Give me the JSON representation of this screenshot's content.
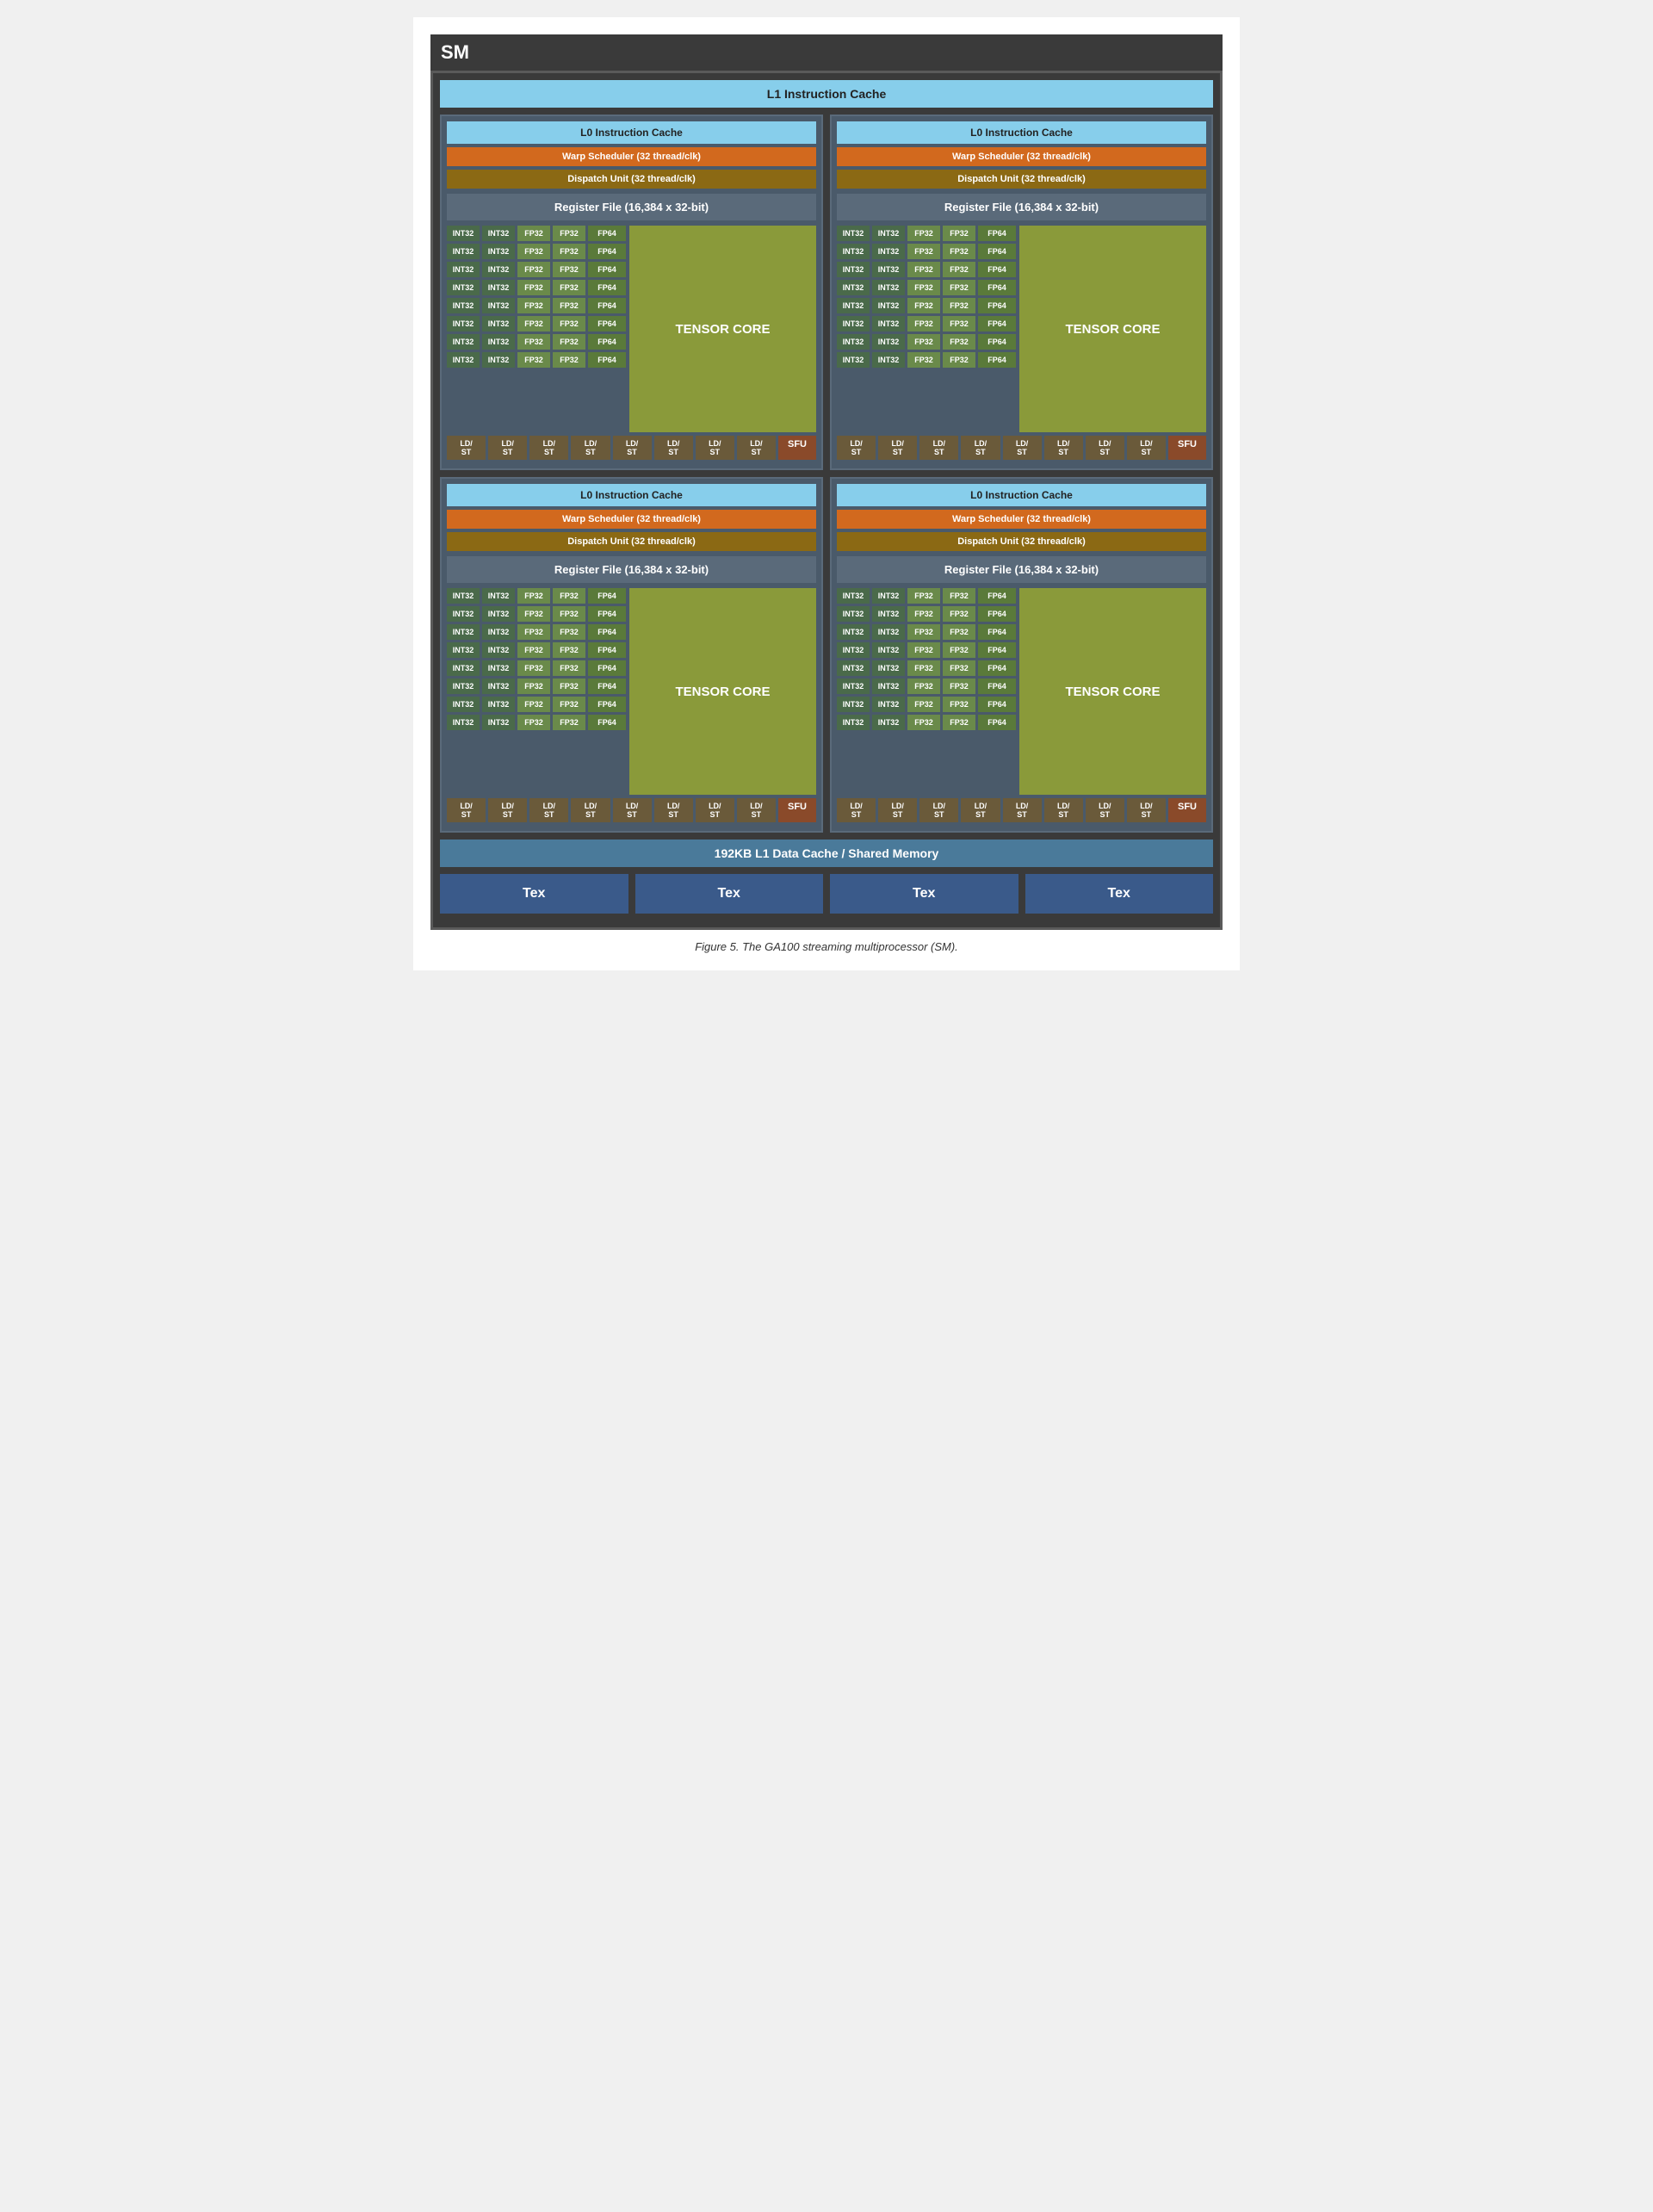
{
  "title": "SM",
  "l1_instruction_cache": "L1 Instruction Cache",
  "l1_data_cache": "192KB L1 Data Cache / Shared Memory",
  "caption": "Figure 5. The GA100 streaming multiprocessor (SM).",
  "quadrants": [
    {
      "l0_cache": "L0 Instruction Cache",
      "warp_scheduler": "Warp Scheduler (32 thread/clk)",
      "dispatch_unit": "Dispatch Unit (32 thread/clk)",
      "register_file": "Register File (16,384 x 32-bit)",
      "tensor_core": "TENSOR CORE",
      "sfu": "SFU"
    },
    {
      "l0_cache": "L0 Instruction Cache",
      "warp_scheduler": "Warp Scheduler (32 thread/clk)",
      "dispatch_unit": "Dispatch Unit (32 thread/clk)",
      "register_file": "Register File (16,384 x 32-bit)",
      "tensor_core": "TENSOR CORE",
      "sfu": "SFU"
    },
    {
      "l0_cache": "L0 Instruction Cache",
      "warp_scheduler": "Warp Scheduler (32 thread/clk)",
      "dispatch_unit": "Dispatch Unit (32 thread/clk)",
      "register_file": "Register File (16,384 x 32-bit)",
      "tensor_core": "TENSOR CORE",
      "sfu": "SFU"
    },
    {
      "l0_cache": "L0 Instruction Cache",
      "warp_scheduler": "Warp Scheduler (32 thread/clk)",
      "dispatch_unit": "Dispatch Unit (32 thread/clk)",
      "register_file": "Register File (16,384 x 32-bit)",
      "tensor_core": "TENSOR CORE",
      "sfu": "SFU"
    }
  ],
  "tex_labels": [
    "Tex",
    "Tex",
    "Tex",
    "Tex"
  ],
  "compute_rows": [
    {
      "int32_1": "INT32",
      "int32_2": "INT32",
      "fp32_1": "FP32",
      "fp32_2": "FP32",
      "fp64": "FP64"
    },
    {
      "int32_1": "INT32",
      "int32_2": "INT32",
      "fp32_1": "FP32",
      "fp32_2": "FP32",
      "fp64": "FP64"
    },
    {
      "int32_1": "INT32",
      "int32_2": "INT32",
      "fp32_1": "FP32",
      "fp32_2": "FP32",
      "fp64": "FP64"
    },
    {
      "int32_1": "INT32",
      "int32_2": "INT32",
      "fp32_1": "FP32",
      "fp32_2": "FP32",
      "fp64": "FP64"
    },
    {
      "int32_1": "INT32",
      "int32_2": "INT32",
      "fp32_1": "FP32",
      "fp32_2": "FP32",
      "fp64": "FP64"
    },
    {
      "int32_1": "INT32",
      "int32_2": "INT32",
      "fp32_1": "FP32",
      "fp32_2": "FP32",
      "fp64": "FP64"
    },
    {
      "int32_1": "INT32",
      "int32_2": "INT32",
      "fp32_1": "FP32",
      "fp32_2": "FP32",
      "fp64": "FP64"
    },
    {
      "int32_1": "INT32",
      "int32_2": "INT32",
      "fp32_1": "FP32",
      "fp32_2": "FP32",
      "fp64": "FP64"
    }
  ],
  "ld_st_label": "LD/\nST"
}
